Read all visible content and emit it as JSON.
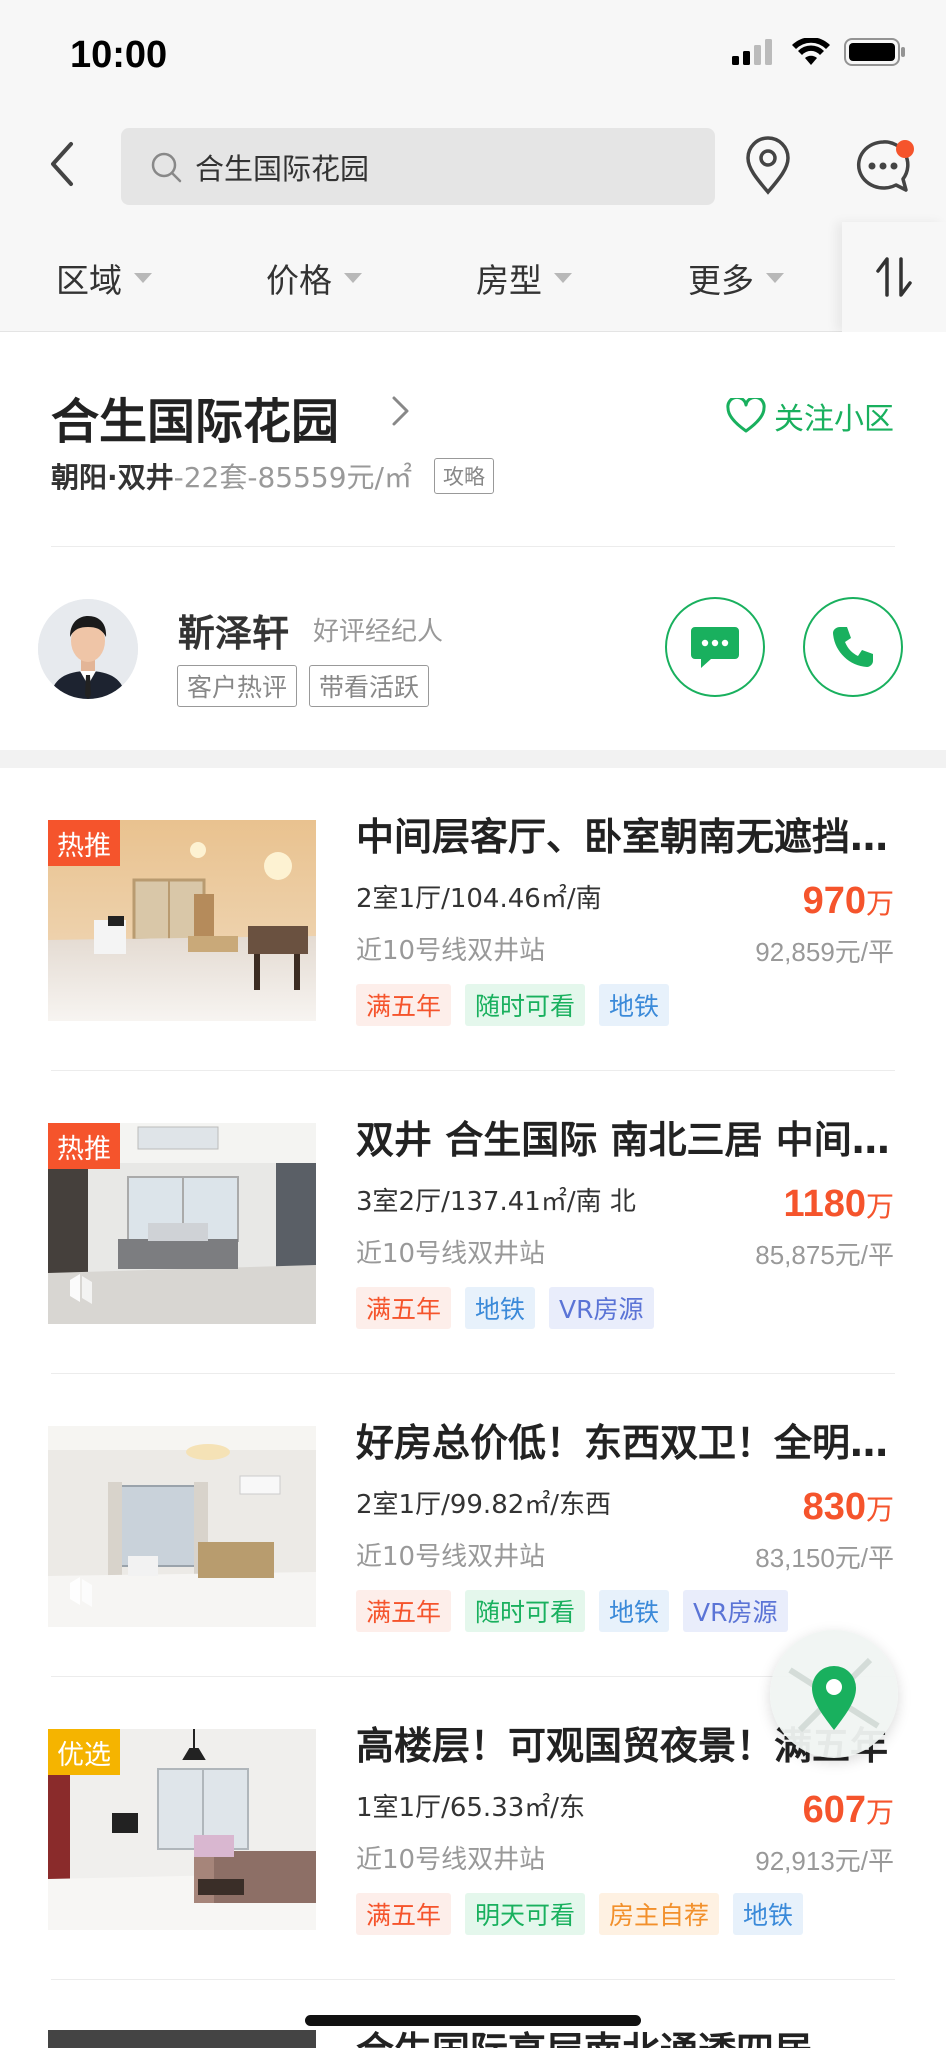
{
  "status_bar": {
    "time": "10:00"
  },
  "search": {
    "value": "合生国际花园",
    "placeholder": ""
  },
  "filters": [
    {
      "label": "区域"
    },
    {
      "label": "价格"
    },
    {
      "label": "房型"
    },
    {
      "label": "更多"
    }
  ],
  "community": {
    "name": "合生国际花园",
    "follow_label": "关注小区",
    "area": "朝阳·双井",
    "stats": "-22套-85559元/㎡",
    "guide_label": "攻略"
  },
  "agent": {
    "name": "靳泽轩",
    "title": "好评经纪人",
    "tags": [
      "客户热评",
      "带看活跃"
    ]
  },
  "listings": [
    {
      "badge": "热推",
      "title": "中间层客厅、卧室朝南无遮挡，满五年",
      "spec": "2室1厅/104.46㎡/南",
      "station": "近10号线双井站",
      "price": "970",
      "price_unit": "万",
      "unit_price": "92,859元/平",
      "tags": [
        "满五年",
        "随时可看",
        "地铁"
      ]
    },
    {
      "badge": "热推",
      "title": "双井 合生国际 南北三居  中间楼层",
      "spec": "3室2厅/137.41㎡/南 北",
      "station": "近10号线双井站",
      "price": "1180",
      "price_unit": "万",
      "unit_price": "85,875元/平",
      "tags": [
        "满五年",
        "地铁",
        "VR房源"
      ]
    },
    {
      "badge": "",
      "title": "好房总价低！东西双卫！全明格局",
      "spec": "2室1厅/99.82㎡/东西",
      "station": "近10号线双井站",
      "price": "830",
      "price_unit": "万",
      "unit_price": "83,150元/平",
      "tags": [
        "满五年",
        "随时可看",
        "地铁",
        "VR房源"
      ]
    },
    {
      "badge": "优选",
      "title": "高楼层！可观国贸夜景！满五年",
      "spec": "1室1厅/65.33㎡/东",
      "station": "近10号线双井站",
      "price": "607",
      "price_unit": "万",
      "unit_price": "92,913元/平",
      "tags": [
        "满五年",
        "明天可看",
        "房主自荐",
        "地铁"
      ]
    }
  ],
  "next_listing": {
    "title": "合生国际高层南北通透四居"
  },
  "colors": {
    "brand_green": "#19b05e",
    "price_red": "#f5542c",
    "badge_yellow": "#f5b400"
  },
  "icons": [
    "back-arrow-icon",
    "search-icon",
    "location-pin-icon",
    "message-icon",
    "sort-icon",
    "heart-icon",
    "chevron-right-icon",
    "chat-bubble-icon",
    "phone-icon",
    "map-pin-icon",
    "vr-icon"
  ]
}
